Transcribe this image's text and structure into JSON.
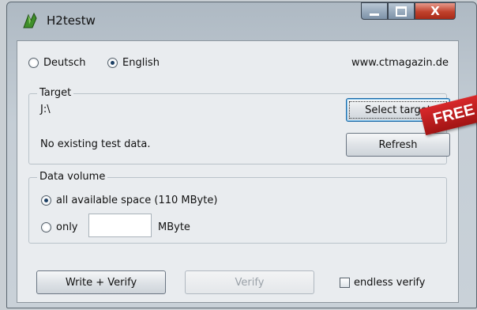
{
  "window": {
    "title": "H2testw",
    "close_glyph": "X"
  },
  "language": {
    "deutsch": "Deutsch",
    "english": "English",
    "selected": "English"
  },
  "url": "www.ctmagazin.de",
  "target": {
    "group_label": "Target",
    "path": "J:\\",
    "status": "No existing test data.",
    "select_button": "Select target",
    "refresh_button": "Refresh"
  },
  "data_volume": {
    "group_label": "Data volume",
    "all_label": "all available space (110 MByte)",
    "only_label": "only",
    "only_value": "",
    "unit": "MByte",
    "selected": "all"
  },
  "actions": {
    "write_verify": "Write + Verify",
    "verify": "Verify",
    "endless_verify": "endless verify"
  },
  "banner": {
    "text": "FREE"
  },
  "colors": {
    "close": "#c0412c",
    "banner": "#c21e20",
    "focus": "#1e6aa6"
  }
}
